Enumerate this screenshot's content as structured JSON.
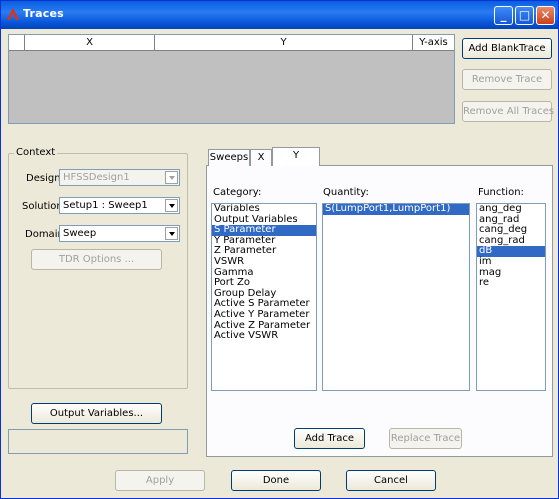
{
  "window": {
    "title": "Traces"
  },
  "traces_table": {
    "columns": [
      "",
      "X",
      "Y",
      "Y-axis"
    ]
  },
  "trace_buttons": {
    "add_blank": "Add BlankTrace",
    "remove": "Remove Trace",
    "remove_all": "Remove All Traces"
  },
  "context": {
    "label": "Context",
    "design_label": "Design:",
    "design_value": "HFSSDesign1",
    "solution_label": "Solution:",
    "solution_value": "Setup1 : Sweep1",
    "domain_label": "Domain:",
    "domain_value": "Sweep",
    "tdr_button": "TDR Options ..."
  },
  "output_variables_button": "Output Variables...",
  "tabs": [
    "Sweeps",
    "X",
    "Y"
  ],
  "category": {
    "label": "Category:",
    "items": [
      "Variables",
      "Output Variables",
      "S Parameter",
      "Y Parameter",
      "Z Parameter",
      "VSWR",
      "Gamma",
      "Port Zo",
      "Group Delay",
      "Active S Parameter",
      "Active Y Parameter",
      "Active Z Parameter",
      "Active VSWR"
    ],
    "selected": 2
  },
  "quantity": {
    "label": "Quantity:",
    "items": [
      "S(LumpPort1,LumpPort1)"
    ],
    "selected": 0
  },
  "function": {
    "label": "Function:",
    "items": [
      "ang_deg",
      "ang_rad",
      "cang_deg",
      "cang_rad",
      "dB",
      "im",
      "mag",
      "re"
    ],
    "selected": 4
  },
  "panel_buttons": {
    "add_trace": "Add Trace",
    "replace_trace": "Replace Trace"
  },
  "bottom_buttons": {
    "apply": "Apply",
    "done": "Done",
    "cancel": "Cancel"
  }
}
